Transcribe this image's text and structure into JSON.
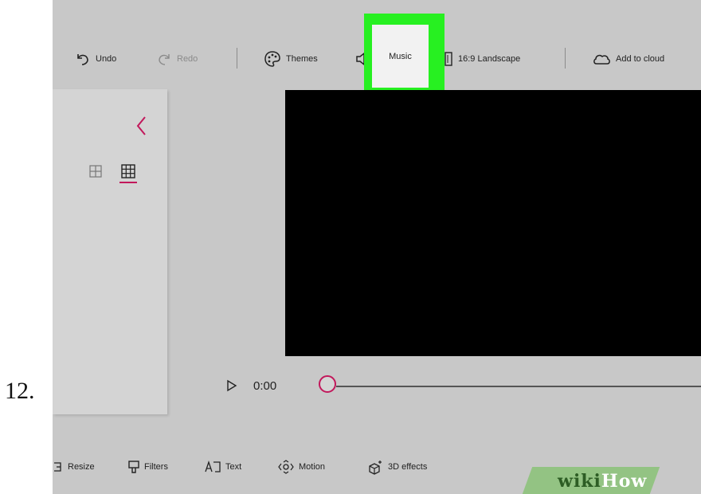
{
  "step_number": "12.",
  "toolbar": {
    "undo_label": "Undo",
    "redo_label": "Redo",
    "themes_label": "Themes",
    "music_label": "Music",
    "aspect_label": "16:9 Landscape",
    "cloud_label": "Add to cloud"
  },
  "playback": {
    "time": "0:00"
  },
  "bottom_toolbar": {
    "resize_label": "Resize",
    "filters_label": "Filters",
    "text_label": "Text",
    "motion_label": "Motion",
    "effects_label": "3D effects"
  },
  "watermark": {
    "wiki": "wiki",
    "how": "How"
  },
  "colors": {
    "accent": "#c2185b",
    "highlight": "#27f021",
    "background": "#c8c8c8",
    "preview": "#000000"
  },
  "icons": [
    "undo-icon",
    "redo-icon",
    "palette-icon",
    "speaker-icon",
    "aspect-ratio-icon",
    "cloud-icon",
    "chevron-left-icon",
    "grid-small-icon",
    "grid-large-icon",
    "play-icon",
    "resize-icon",
    "filters-icon",
    "text-icon",
    "motion-icon",
    "3d-effects-icon"
  ]
}
